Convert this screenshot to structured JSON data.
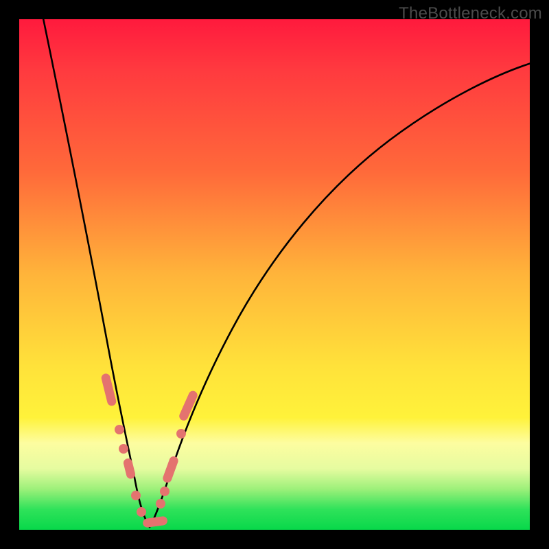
{
  "watermark": "TheBottleneck.com",
  "colors": {
    "gradient_top": "#ff1a3d",
    "gradient_mid1": "#ff6a3a",
    "gradient_mid2": "#ffe23a",
    "gradient_bottom": "#08d84a",
    "curve": "#000000",
    "marker": "#e4736f",
    "frame": "#000000"
  },
  "chart_data": {
    "type": "line",
    "title": "",
    "xlabel": "",
    "ylabel": "",
    "xlim": [
      0,
      100
    ],
    "ylim": [
      0,
      100
    ],
    "grid": false,
    "legend": false,
    "note": "Two curves descending into a V-shaped minimum near x≈22–27 with bottleneck pct ≈0; coarse estimates read from pixels. Values are bottleneck percentage descending to 0 then rising.",
    "series": [
      {
        "name": "left-branch",
        "x": [
          0,
          3,
          6,
          9,
          12,
          15,
          17,
          19,
          20,
          21,
          22,
          23,
          24,
          25
        ],
        "y": [
          100,
          86,
          72,
          58,
          46,
          36,
          28,
          20,
          15,
          11,
          7,
          4,
          2,
          0
        ]
      },
      {
        "name": "right-branch",
        "x": [
          25,
          27,
          28,
          29,
          30,
          33,
          37,
          42,
          48,
          55,
          63,
          72,
          82,
          92,
          100
        ],
        "y": [
          0,
          2,
          5,
          9,
          13,
          22,
          33,
          44,
          54,
          62,
          70,
          77,
          83,
          87,
          90
        ]
      }
    ],
    "markers_note": "Salmon dots/segments cluster along both branches near the bottom ~25% of plot height (low bottleneck region).",
    "markers": [
      {
        "branch": "left",
        "x": 17.5,
        "y": 26,
        "shape": "pill",
        "len": 6
      },
      {
        "branch": "left",
        "x": 19.8,
        "y": 17,
        "shape": "dot"
      },
      {
        "branch": "left",
        "x": 20.6,
        "y": 13,
        "shape": "dot"
      },
      {
        "branch": "left",
        "x": 21.6,
        "y": 9,
        "shape": "pill",
        "len": 3
      },
      {
        "branch": "left",
        "x": 23.0,
        "y": 5,
        "shape": "dot"
      },
      {
        "branch": "left",
        "x": 24.2,
        "y": 2,
        "shape": "dot"
      },
      {
        "branch": "right",
        "x": 25.0,
        "y": 0,
        "shape": "pill",
        "len": 4
      },
      {
        "branch": "right",
        "x": 27.4,
        "y": 4,
        "shape": "dot"
      },
      {
        "branch": "right",
        "x": 28.0,
        "y": 7,
        "shape": "dot"
      },
      {
        "branch": "right",
        "x": 29.4,
        "y": 12,
        "shape": "pill",
        "len": 4
      },
      {
        "branch": "right",
        "x": 31.2,
        "y": 19,
        "shape": "dot"
      },
      {
        "branch": "right",
        "x": 32.4,
        "y": 23,
        "shape": "pill",
        "len": 5
      }
    ]
  }
}
